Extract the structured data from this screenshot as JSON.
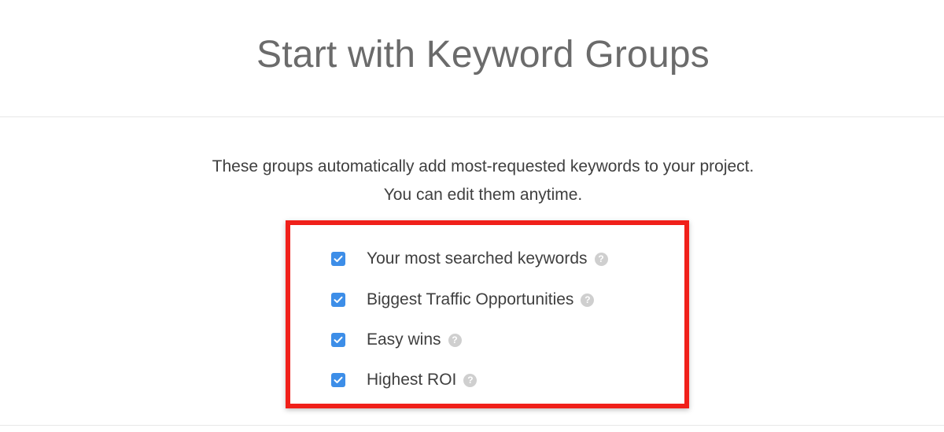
{
  "page": {
    "title": "Start with Keyword Groups",
    "description_line1": "These groups automatically add most-requested keywords to your project.",
    "description_line2": "You can edit them anytime."
  },
  "keyword_groups": [
    {
      "label": "Your most searched keywords",
      "checked": true,
      "help_icon": "question-circle"
    },
    {
      "label": "Biggest Traffic Opportunities",
      "checked": true,
      "help_icon": "question-circle"
    },
    {
      "label": "Easy wins",
      "checked": true,
      "help_icon": "question-circle"
    },
    {
      "label": "Highest ROI",
      "checked": true,
      "help_icon": "question-circle"
    }
  ],
  "colors": {
    "checkbox": "#3d8ee8",
    "highlight_border": "#f0201a",
    "help_icon": "#cfcfcf"
  }
}
